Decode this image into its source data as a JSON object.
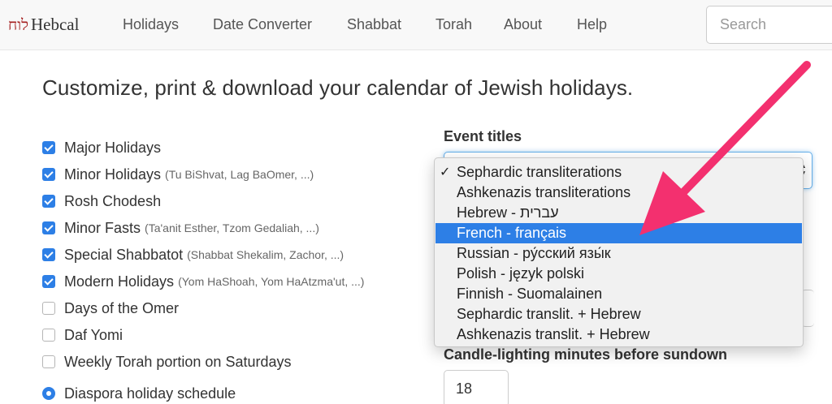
{
  "header": {
    "logo_hebrew": "לוח",
    "logo_text": "Hebcal",
    "nav": [
      "Holidays",
      "Date Converter",
      "Shabbat",
      "Torah",
      "About",
      "Help"
    ],
    "search_placeholder": "Search"
  },
  "page": {
    "headline": "Customize, print & download your calendar of Jewish holidays."
  },
  "options": [
    {
      "label": "Major Holidays",
      "hint": "",
      "checked": true
    },
    {
      "label": "Minor Holidays",
      "hint": "(Tu BiShvat, Lag BaOmer, ...)",
      "checked": true
    },
    {
      "label": "Rosh Chodesh",
      "hint": "",
      "checked": true
    },
    {
      "label": "Minor Fasts",
      "hint": "(Ta'anit Esther, Tzom Gedaliah, ...)",
      "checked": true
    },
    {
      "label": "Special Shabbatot",
      "hint": "(Shabbat Shekalim, Zachor, ...)",
      "checked": true
    },
    {
      "label": "Modern Holidays",
      "hint": "(Yom HaShoah, Yom HaAtzma'ut, ...)",
      "checked": true
    },
    {
      "label": "Days of the Omer",
      "hint": "",
      "checked": false
    },
    {
      "label": "Daf Yomi",
      "hint": "",
      "checked": false
    },
    {
      "label": "Weekly Torah portion on Saturdays",
      "hint": "",
      "checked": false
    }
  ],
  "schedule": {
    "label": "Diaspora holiday schedule",
    "selected": true
  },
  "event_titles": {
    "label": "Event titles",
    "options": [
      "Sephardic transliterations",
      "Ashkenazis transliterations",
      "Hebrew - עברית",
      "French - français",
      "Russian - ру́сский язы́к",
      "Polish - język polski",
      "Finnish - Suomalainen",
      "Sephardic translit. + Hebrew",
      "Ashkenazis translit. + Hebrew"
    ],
    "checked_index": 0,
    "highlighted_index": 3,
    "check_mark": "✓"
  },
  "candle_lighting": {
    "label": "Candle-lighting minutes before sundown",
    "value": "18"
  },
  "colors": {
    "accent": "#2d7fe6",
    "annotation_arrow": "#f3306f",
    "logo_hebrew": "#a41e1e"
  }
}
